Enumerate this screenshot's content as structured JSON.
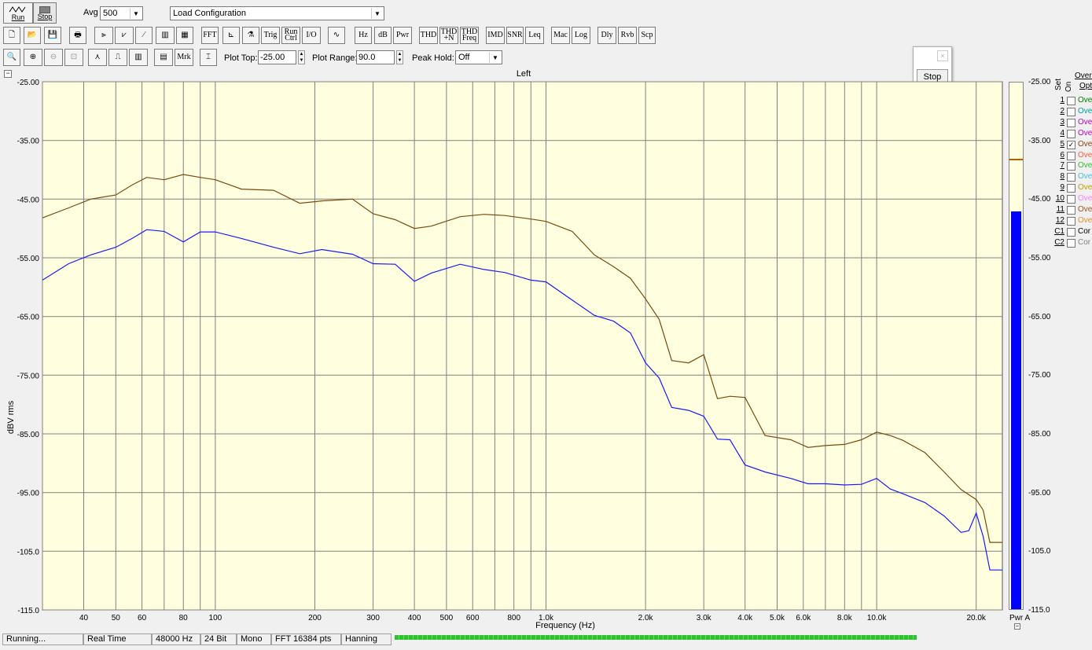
{
  "toolbar1": {
    "run": "Run",
    "stop": "Stop",
    "avg_label": "Avg",
    "avg_value": "500",
    "config": "Load Configuration"
  },
  "toolbar2": {
    "buttons": [
      "FFT",
      "Trig",
      "Run Ctrl",
      "I/O",
      "Hz",
      "dB",
      "Pwr",
      "THD",
      "THD +N",
      "THD Freq",
      "IMD",
      "SNR",
      "Leq",
      "Mac",
      "Log",
      "Dly",
      "Rvb",
      "Scp"
    ]
  },
  "toolbar3": {
    "mrk": "Mrk",
    "plot_top_label": "Plot Top:",
    "plot_top_value": "-25.00",
    "plot_range_label": "Plot Range:",
    "plot_range_value": "90.0",
    "peak_hold_label": "Peak Hold:",
    "peak_hold_value": "Off"
  },
  "stop_popup": {
    "label": "Stop"
  },
  "chart_data": {
    "type": "line",
    "title": "Left",
    "xlabel": "Frequency (Hz)",
    "ylabel": "dBV rms",
    "x_scale": "log",
    "xlim": [
      30,
      24000
    ],
    "ylim": [
      -115,
      -25
    ],
    "grid": true,
    "background": "#ffffe0",
    "yticks": [
      "-25.00",
      "-35.00",
      "-45.00",
      "-55.00",
      "-65.00",
      "-75.00",
      "-85.00",
      "-95.00",
      "-105.0",
      "-115.0"
    ],
    "xticks": [
      "40",
      "50",
      "60",
      "80",
      "100",
      "200",
      "300",
      "400",
      "500",
      "600",
      "800",
      "1.0k",
      "2.0k",
      "3.0k",
      "4.0k",
      "5.0k",
      "6.0k",
      "8.0k",
      "10.0k",
      "20.0k"
    ],
    "series": [
      {
        "color": "#7a4a10",
        "x": [
          30,
          36,
          42,
          50,
          56,
          62,
          70,
          80,
          90,
          100,
          120,
          150,
          180,
          210,
          260,
          300,
          350,
          400,
          450,
          550,
          650,
          750,
          900,
          1000,
          1200,
          1400,
          1600,
          1800,
          2000,
          2200,
          2400,
          2700,
          3000,
          3300,
          3600,
          4000,
          4600,
          5500,
          6200,
          7000,
          8000,
          9000,
          10000,
          11000,
          12000,
          14000,
          16000,
          18000,
          20000,
          21000,
          22000,
          24000
        ],
        "y": [
          -48.2,
          -46.5,
          -45,
          -44.3,
          -42.6,
          -41.3,
          -41.7,
          -40.8,
          -41.3,
          -41.7,
          -43.3,
          -43.5,
          -45.7,
          -45.3,
          -45,
          -47.5,
          -48.5,
          -50,
          -49.6,
          -48,
          -47.6,
          -47.8,
          -48.4,
          -48.8,
          -50.5,
          -54.5,
          -56.5,
          -58.5,
          -62,
          -65.5,
          -72.5,
          -72.9,
          -71.5,
          -79,
          -78.6,
          -78.8,
          -85.3,
          -86,
          -87.3,
          -87,
          -86.8,
          -86,
          -84.7,
          -85.3,
          -86.1,
          -88.2,
          -91.5,
          -94.5,
          -96.2,
          -98,
          -103.5,
          -103.5
        ]
      },
      {
        "color": "#1a1aff",
        "x": [
          30,
          36,
          42,
          50,
          56,
          62,
          70,
          80,
          90,
          100,
          120,
          150,
          180,
          210,
          260,
          300,
          350,
          400,
          450,
          550,
          650,
          750,
          900,
          1000,
          1200,
          1400,
          1600,
          1800,
          2000,
          2200,
          2400,
          2700,
          3000,
          3300,
          3600,
          4000,
          4600,
          5500,
          6200,
          7000,
          8000,
          9000,
          10000,
          11000,
          12000,
          14000,
          16000,
          18000,
          19000,
          20000,
          21000,
          22000,
          24000
        ],
        "y": [
          -58.8,
          -56,
          -54.5,
          -53.2,
          -51.7,
          -50.2,
          -50.5,
          -52.3,
          -50.6,
          -50.6,
          -51.7,
          -53.2,
          -54.3,
          -53.6,
          -54.4,
          -56,
          -56.1,
          -59,
          -57.6,
          -56.1,
          -57,
          -57.5,
          -58.8,
          -59.1,
          -62.2,
          -64.8,
          -65.8,
          -67.8,
          -72.9,
          -75.5,
          -80.5,
          -81,
          -82,
          -85.9,
          -86,
          -90.3,
          -91.5,
          -92.6,
          -93.5,
          -93.5,
          -93.7,
          -93.6,
          -92.6,
          -94.4,
          -95.2,
          -96.7,
          -99,
          -101.8,
          -101.5,
          -98.5,
          -102.5,
          -108.2,
          -108.2
        ]
      }
    ]
  },
  "meter": {
    "label": "Pwr A",
    "level_fraction": 0.755
  },
  "right_axis": [
    "-25.00",
    "-35.00",
    "-45.00",
    "-55.00",
    "-65.00",
    "-75.00",
    "-85.00",
    "-95.00",
    "-105.0",
    "-115.0"
  ],
  "overlay": {
    "header": "Overl",
    "set_label": "Set",
    "on_label": "On",
    "opt_label": "Opt",
    "rows": [
      {
        "n": "1",
        "text": "Ove",
        "color": "#008000",
        "checked": ""
      },
      {
        "n": "2",
        "text": "Ove",
        "color": "#00a0a0",
        "checked": ""
      },
      {
        "n": "3",
        "text": "Ove",
        "color": "#c000c0",
        "checked": ""
      },
      {
        "n": "4",
        "text": "Ove",
        "color": "#c000c0",
        "checked": ""
      },
      {
        "n": "5",
        "text": "Ove",
        "color": "#8b4513",
        "checked": "✓"
      },
      {
        "n": "6",
        "text": "Ove",
        "color": "#ff6040",
        "checked": ""
      },
      {
        "n": "7",
        "text": "Ove",
        "color": "#30c030",
        "checked": ""
      },
      {
        "n": "8",
        "text": "Ove",
        "color": "#40c0e0",
        "checked": ""
      },
      {
        "n": "9",
        "text": "Ove",
        "color": "#c0a000",
        "checked": ""
      },
      {
        "n": "10",
        "text": "Ove",
        "color": "#ff80ff",
        "checked": ""
      },
      {
        "n": "11",
        "text": "Ove",
        "color": "#a05020",
        "checked": ""
      },
      {
        "n": "12",
        "text": "Ove",
        "color": "#e09030",
        "checked": ""
      },
      {
        "n": "C1",
        "text": "Cor",
        "color": "#000000",
        "checked": ""
      },
      {
        "n": "C2",
        "text": "Cor",
        "color": "#808080",
        "checked": ""
      }
    ]
  },
  "status": {
    "state": "Running...",
    "mode": "Real Time",
    "rate": "48000 Hz",
    "bits": "24 Bit",
    "channels": "Mono",
    "fft": "FFT 16384 pts",
    "window": "Hanning",
    "progress_fraction": 1.0
  }
}
